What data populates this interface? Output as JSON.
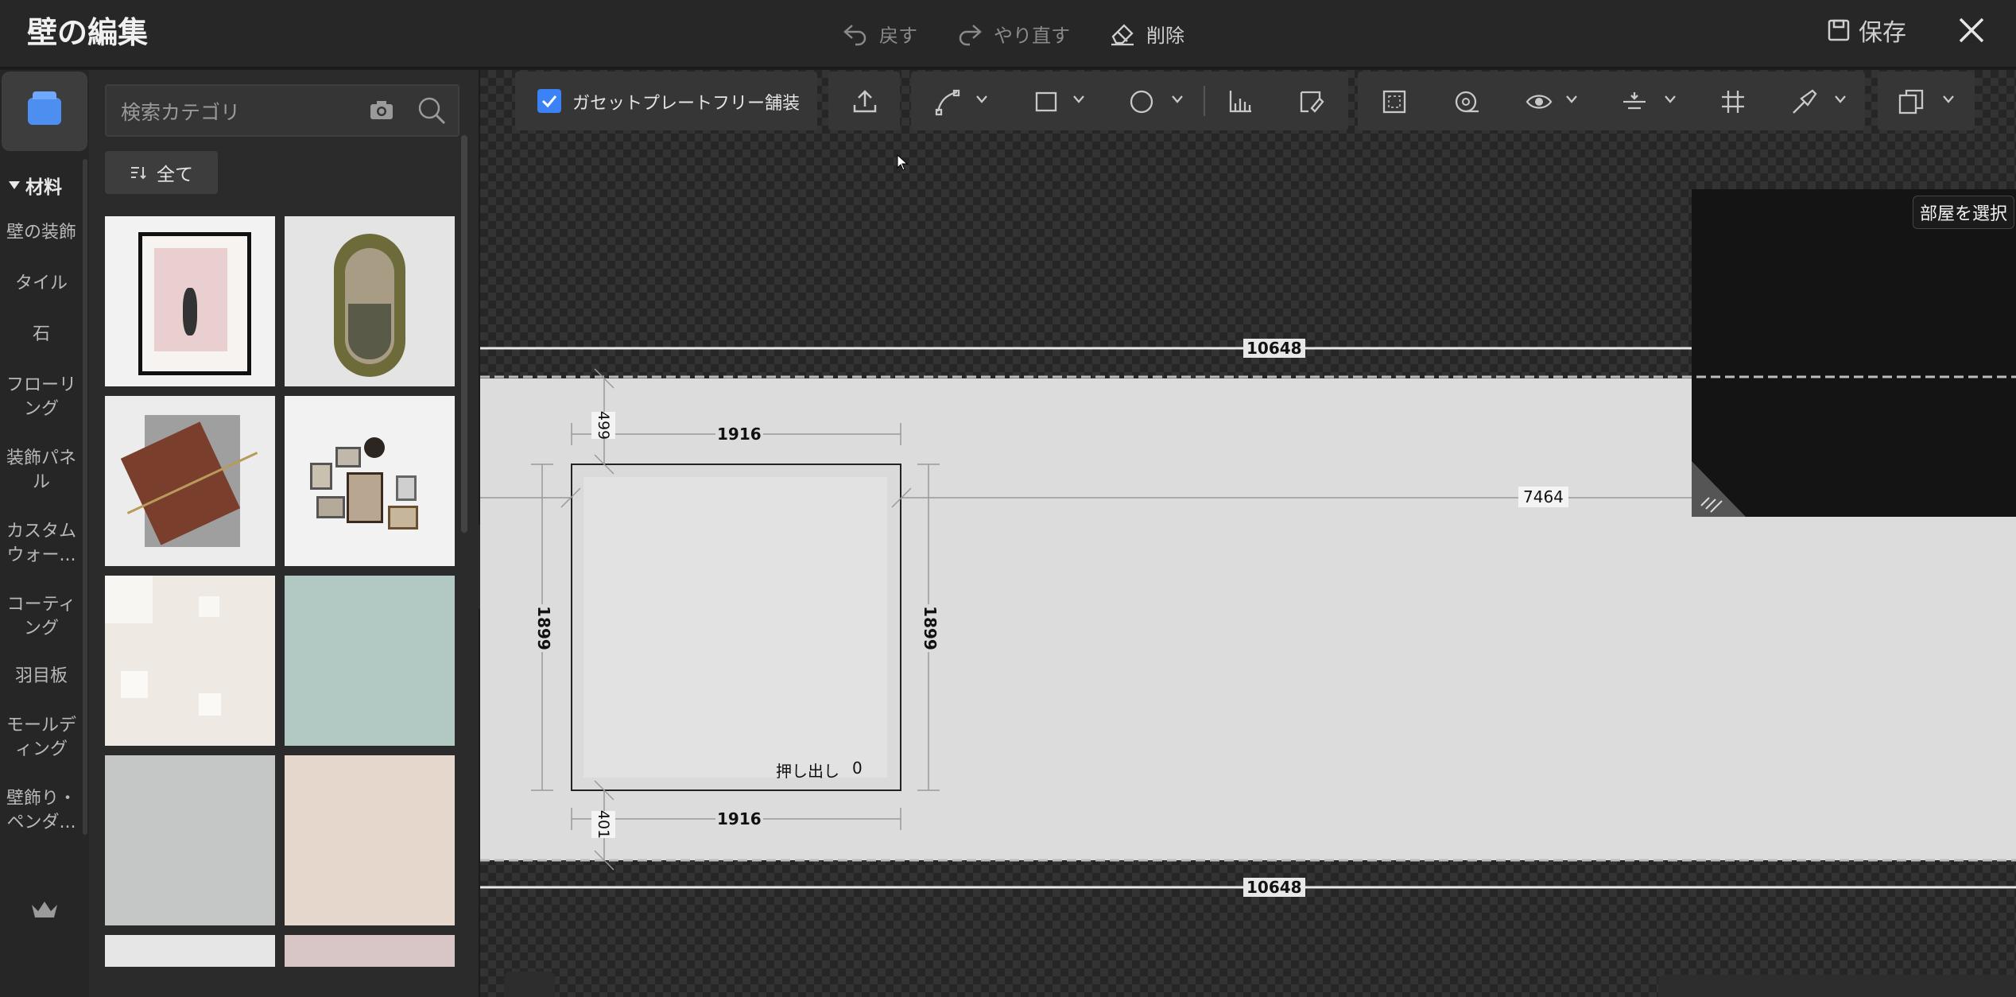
{
  "header": {
    "title": "壁の編集",
    "undo_label": "戻す",
    "redo_label": "やり直す",
    "delete_label": "削除",
    "save_label": "保存"
  },
  "sidebar": {
    "section_label": "材料",
    "items": [
      {
        "label": "壁の装飾"
      },
      {
        "label": "タイル"
      },
      {
        "label": "石"
      },
      {
        "label": "フローリ\nング"
      },
      {
        "label": "装飾パネ\nル"
      },
      {
        "label": "カスタム\nウォー..."
      },
      {
        "label": "コーティ\nング"
      },
      {
        "label": "羽目板"
      },
      {
        "label": "モールデ\nィング"
      },
      {
        "label": "壁飾り・\nペンダ..."
      }
    ]
  },
  "library": {
    "search_placeholder": "検索カテゴリ",
    "filter_label": "全て"
  },
  "toolbar": {
    "checkbox_label": "ガセットプレートフリー舗装",
    "checkbox_checked": true
  },
  "canvas": {
    "room_select_label": "部屋を選択",
    "dimensions": {
      "wall_width_top": "10648",
      "wall_width_bottom": "10648",
      "opening_width_top": "1916",
      "opening_width_bottom": "1916",
      "opening_height_left": "1899",
      "opening_height_right": "1899",
      "offset_top": "499",
      "offset_bottom": "401",
      "offset_right": "7464"
    },
    "extrude_label": "押し出し",
    "extrude_value": "0"
  },
  "colors": {
    "accent": "#3b82f6",
    "canvas_bg": "#262626",
    "wall": "#dcdcdc"
  }
}
